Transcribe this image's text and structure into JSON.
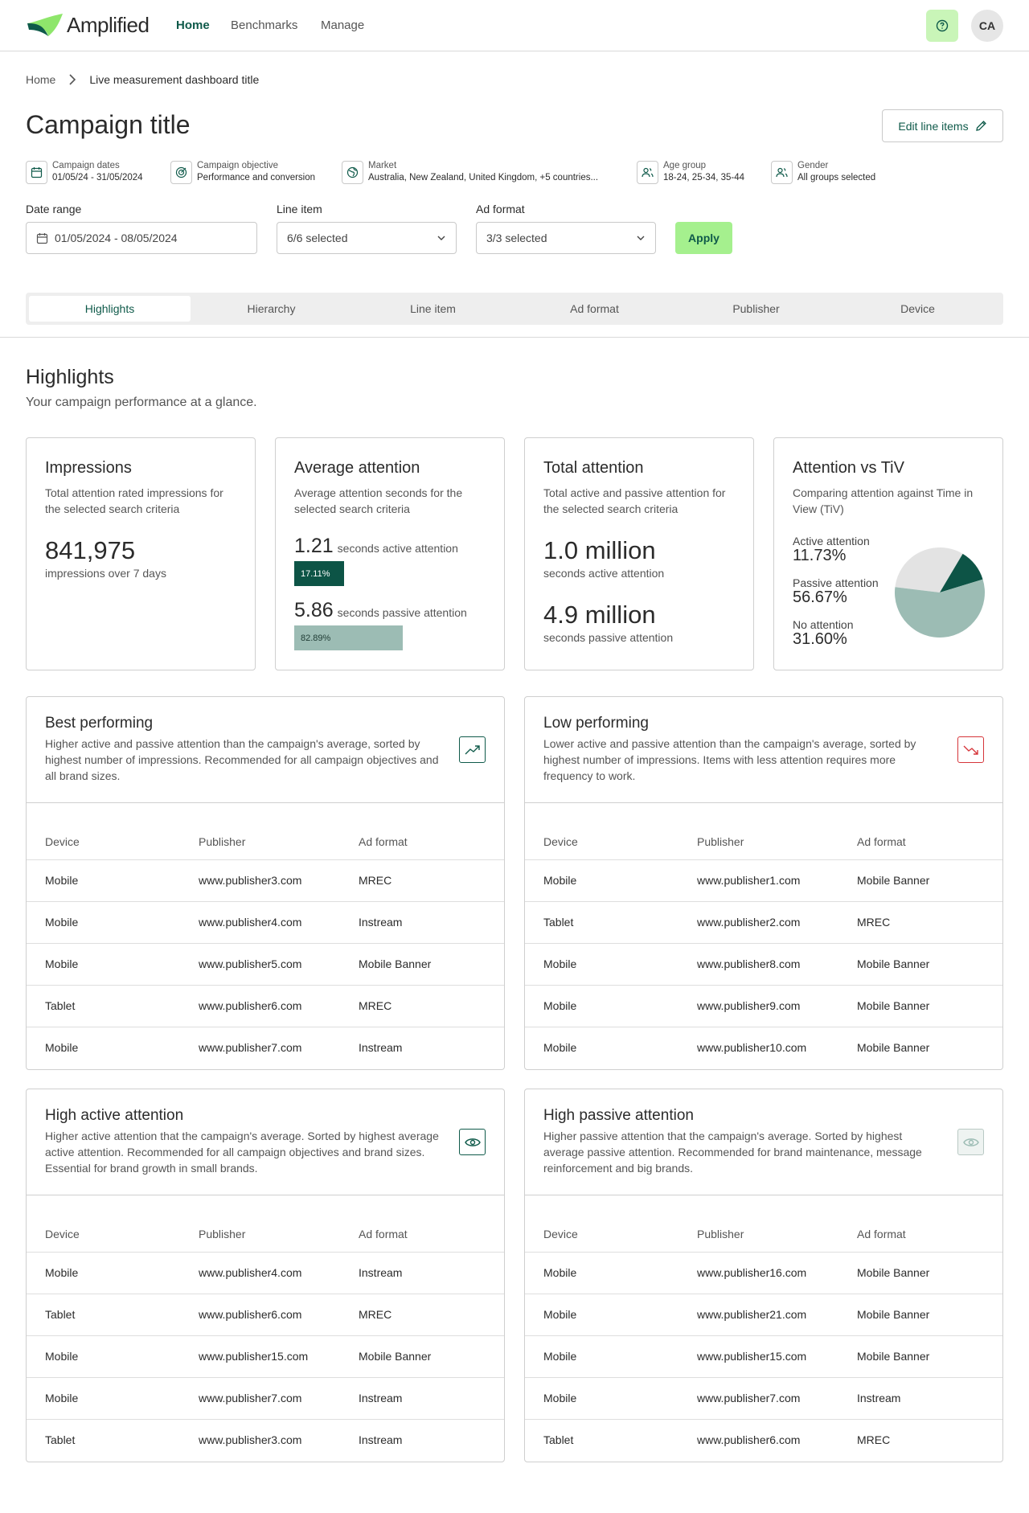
{
  "app": {
    "logo_text": "Amplified"
  },
  "nav": {
    "links": [
      "Home",
      "Benchmarks",
      "Manage"
    ],
    "avatar_initials": "CA"
  },
  "breadcrumb": {
    "home": "Home",
    "current": "Live measurement dashboard title"
  },
  "page": {
    "title": "Campaign title",
    "edit_label": "Edit line items"
  },
  "meta": [
    {
      "icon": "calendar-icon",
      "label": "Campaign dates",
      "value": "01/05/24 - 31/05/2024"
    },
    {
      "icon": "target-icon",
      "label": "Campaign objective",
      "value": "Performance and conversion"
    },
    {
      "icon": "globe-icon",
      "label": "Market",
      "value": "Australia, New Zealand, United Kingdom, +5 countries..."
    },
    {
      "icon": "users-icon",
      "label": "Age group",
      "value": "18-24, 25-34, 35-44"
    },
    {
      "icon": "users-icon",
      "label": "Gender",
      "value": "All groups selected"
    }
  ],
  "filters": {
    "date_range": {
      "label": "Date range",
      "value": "01/05/2024 - 08/05/2024"
    },
    "line_item": {
      "label": "Line item",
      "value": "6/6 selected"
    },
    "ad_format": {
      "label": "Ad format",
      "value": "3/3 selected"
    },
    "apply_label": "Apply"
  },
  "tabs": [
    "Highlights",
    "Hierarchy",
    "Line item",
    "Ad format",
    "Publisher",
    "Device"
  ],
  "highlights": {
    "title": "Highlights",
    "subtitle": "Your campaign performance at a glance."
  },
  "cards": {
    "impressions": {
      "title": "Impressions",
      "desc": "Total attention rated impressions for the selected search criteria",
      "value": "841,975",
      "value_sub": "impressions over 7 days"
    },
    "average": {
      "title": "Average attention",
      "desc": "Average attention seconds for the selected search criteria",
      "active_value": "1.21",
      "active_label": "seconds active attention",
      "active_pct": "17.11%",
      "passive_value": "5.86",
      "passive_label": "seconds passive attention",
      "passive_pct": "82.89%"
    },
    "total": {
      "title": "Total attention",
      "desc": "Total active and passive attention for the selected search criteria",
      "active_value": "1.0 million",
      "active_label": "seconds active attention",
      "passive_value": "4.9 million",
      "passive_label": "seconds passive attention"
    },
    "tiv": {
      "title": "Attention vs TiV",
      "desc": "Comparing attention against Time in View (TiV)",
      "items": [
        {
          "label": "Active attention",
          "value": "11.73%",
          "share": 0.1173,
          "color": "#0d5446"
        },
        {
          "label": "Passive attention",
          "value": "56.67%",
          "share": 0.5667,
          "color": "#9cbcb4"
        },
        {
          "label": "No attention",
          "value": "31.60%",
          "share": 0.316,
          "color": "#e3e3e3"
        }
      ]
    }
  },
  "tables": [
    {
      "title": "Best performing",
      "desc": "Higher active and passive attention than the campaign's average, sorted by highest number of impressions. Recommended for all campaign objectives and all brand sizes.",
      "icon": "trending-up-icon",
      "columns": [
        "Device",
        "Publisher",
        "Ad format"
      ],
      "rows": [
        [
          "Mobile",
          "www.publisher3.com",
          "MREC"
        ],
        [
          "Mobile",
          "www.publisher4.com",
          "Instream"
        ],
        [
          "Mobile",
          "www.publisher5.com",
          "Mobile Banner"
        ],
        [
          "Tablet",
          "www.publisher6.com",
          "MREC"
        ],
        [
          "Mobile",
          "www.publisher7.com",
          "Instream"
        ]
      ]
    },
    {
      "title": "Low performing",
      "desc": "Lower active and passive attention than the campaign's average, sorted by highest number of impressions. Items with less attention requires more frequency to work.",
      "icon": "trending-down-icon",
      "columns": [
        "Device",
        "Publisher",
        "Ad format"
      ],
      "rows": [
        [
          "Mobile",
          "www.publisher1.com",
          "Mobile Banner"
        ],
        [
          "Tablet",
          "www.publisher2.com",
          "MREC"
        ],
        [
          "Mobile",
          "www.publisher8.com",
          "Mobile Banner"
        ],
        [
          "Mobile",
          "www.publisher9.com",
          "Mobile Banner"
        ],
        [
          "Mobile",
          "www.publisher10.com",
          "Mobile Banner"
        ]
      ]
    },
    {
      "title": "High active attention",
      "desc": "Higher active attention that the campaign's average. Sorted by highest average active attention. Recommended for all campaign objectives and brand sizes. Essential for brand growth in small brands.",
      "icon": "eye-icon",
      "columns": [
        "Device",
        "Publisher",
        "Ad format"
      ],
      "rows": [
        [
          "Mobile",
          "www.publisher4.com",
          "Instream"
        ],
        [
          "Tablet",
          "www.publisher6.com",
          "MREC"
        ],
        [
          "Mobile",
          "www.publisher15.com",
          "Mobile Banner"
        ],
        [
          "Mobile",
          "www.publisher7.com",
          "Instream"
        ],
        [
          "Tablet",
          "www.publisher3.com",
          "Instream"
        ]
      ]
    },
    {
      "title": "High passive attention",
      "desc": "Higher passive attention that the campaign's average. Sorted by highest average passive attention. Recommended for brand maintenance, message reinforcement and big brands.",
      "icon": "eye-icon",
      "columns": [
        "Device",
        "Publisher",
        "Ad format"
      ],
      "rows": [
        [
          "Mobile",
          "www.publisher16.com",
          "Mobile Banner"
        ],
        [
          "Mobile",
          "www.publisher21.com",
          "Mobile Banner"
        ],
        [
          "Mobile",
          "www.publisher15.com",
          "Mobile Banner"
        ],
        [
          "Mobile",
          "www.publisher7.com",
          "Instream"
        ],
        [
          "Tablet",
          "www.publisher6.com",
          "MREC"
        ]
      ]
    }
  ]
}
